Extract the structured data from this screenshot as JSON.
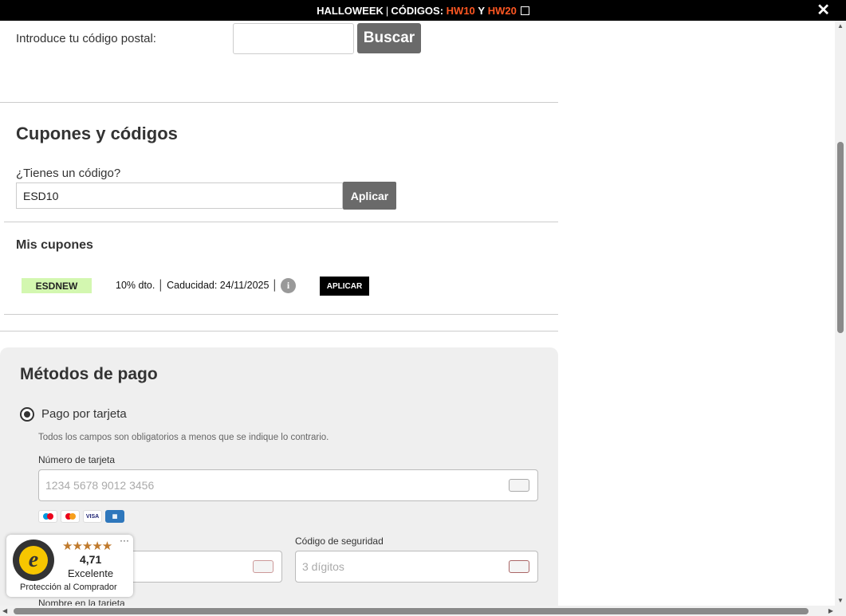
{
  "topbar": {
    "promo": "HALLOWEEK",
    "codes_label": "CÓDIGOS:",
    "code1": "HW10",
    "and": "Y",
    "code2": "HW20",
    "close": "✕"
  },
  "postal": {
    "label": "Introduce tu código postal:",
    "button": "Buscar"
  },
  "coupons": {
    "title": "Cupones y códigos",
    "question": "¿Tienes un código?",
    "value": "ESD10",
    "apply": "Aplicar"
  },
  "my_coupons": {
    "title": "Mis cupones",
    "items": [
      {
        "code": "ESDNEW",
        "desc": "10% dto. │ Caducidad: 24/11/2025 │",
        "apply": "APLICAR"
      }
    ]
  },
  "payment": {
    "title": "Métodos de pago",
    "option": "Pago por tarjeta",
    "notice": "Todos los campos son obligatorios a menos que se indique lo contrario.",
    "card_label": "Número de tarjeta",
    "card_placeholder": "1234 5678 9012 3456",
    "brands": [
      "maestro",
      "mastercard",
      "VISA",
      "amex"
    ],
    "cvc_label": "Código de seguridad",
    "cvc_placeholder": "3 dígitos",
    "name_label": "Nombre en la tarjeta"
  },
  "trusted_shops": {
    "score": "4,71",
    "rating": "Excelente",
    "protection": "Protección al Comprador",
    "stars": "★★★★★",
    "seal_letter": "e"
  }
}
